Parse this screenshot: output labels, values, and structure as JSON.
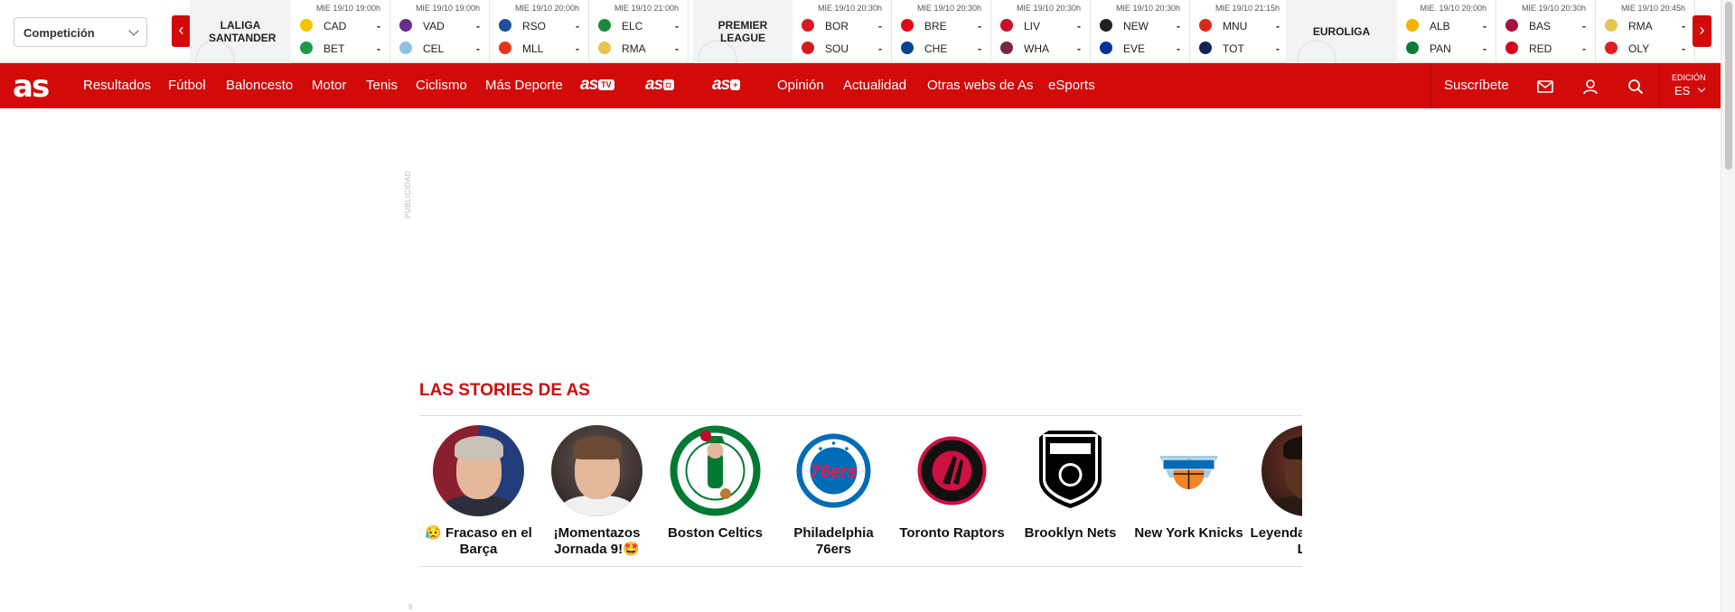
{
  "scoreboard": {
    "competition_select": "Competición",
    "prev_label": "‹",
    "next_label": "›",
    "competitions": [
      {
        "name": "LALIGA SANTANDER"
      },
      {
        "name": "PREMIER LEAGUE"
      },
      {
        "name": "EUROLIGA"
      }
    ],
    "matches": [
      {
        "date": "MIE 19/10 19:00h",
        "home": "CAD",
        "away": "BET",
        "home_score": "-",
        "away_score": "-",
        "home_color": "#f2c500",
        "away_color": "#1a9a4a"
      },
      {
        "date": "MIE 19/10 19:00h",
        "home": "VAD",
        "away": "CEL",
        "home_score": "-",
        "away_score": "-",
        "home_color": "#6b2d8a",
        "away_color": "#8fc1e3"
      },
      {
        "date": "MIE 19/10 20:00h",
        "home": "RSO",
        "away": "MLL",
        "home_score": "-",
        "away_score": "-",
        "home_color": "#1d4f9c",
        "away_color": "#e5361b"
      },
      {
        "date": "MIE 19/10 21:00h",
        "home": "ELC",
        "away": "RMA",
        "home_score": "-",
        "away_score": "-",
        "home_color": "#1b8a3e",
        "away_color": "#e7c450"
      },
      {
        "date": "MIE 19/10 20:30h",
        "home": "BOR",
        "away": "SOU",
        "home_score": "-",
        "away_score": "-",
        "home_color": "#d71920",
        "away_color": "#d71920"
      },
      {
        "date": "MIE 19/10 20:30h",
        "home": "BRE",
        "away": "CHE",
        "home_score": "-",
        "away_score": "-",
        "home_color": "#e30613",
        "away_color": "#034694"
      },
      {
        "date": "MIE 19/10 20:30h",
        "home": "LIV",
        "away": "WHA",
        "home_score": "-",
        "away_score": "-",
        "home_color": "#c8102e",
        "away_color": "#7a263a"
      },
      {
        "date": "MIE 19/10 20:30h",
        "home": "NEW",
        "away": "EVE",
        "home_score": "-",
        "away_score": "-",
        "home_color": "#241f20",
        "away_color": "#003399"
      },
      {
        "date": "MIE 19/10 21:15h",
        "home": "MNU",
        "away": "TOT",
        "home_score": "-",
        "away_score": "-",
        "home_color": "#da291c",
        "away_color": "#132257"
      },
      {
        "date": "MIE. 19/10 20:00h",
        "home": "ALB",
        "away": "PAN",
        "home_score": "-",
        "away_score": "-",
        "home_color": "#f2b400",
        "away_color": "#0a7d3b"
      },
      {
        "date": "MIE 19/10 20:30h",
        "home": "BAS",
        "away": "RED",
        "home_score": "-",
        "away_score": "-",
        "home_color": "#a4123f",
        "away_color": "#d6001c"
      },
      {
        "date": "MIE 19/10 20:45h",
        "home": "RMA",
        "away": "OLY",
        "home_score": "-",
        "away_score": "-",
        "home_color": "#e7c450",
        "away_color": "#e31b23"
      }
    ]
  },
  "nav": {
    "logo": "as",
    "items": [
      "Resultados",
      "Fútbol",
      "Baloncesto",
      "Motor",
      "Tenis",
      "Ciclismo",
      "Más Deporte"
    ],
    "brand_tv": "as",
    "brand_tv_tag": "TV",
    "brand_photo": "as",
    "brand_photo_tag": "◘",
    "brand_plus": "as",
    "brand_plus_tag": "+",
    "items2": [
      "Opinión",
      "Actualidad",
      "Otras webs de As",
      "eSports"
    ],
    "subscribe": "Suscríbete",
    "edition_label": "EDICIÓN",
    "edition_value": "ES"
  },
  "ad": {
    "label": "PUBLICIDAD",
    "label2": "9"
  },
  "stories": {
    "title": "LAS STORIES DE AS",
    "items": [
      {
        "caption": "😥 Fracaso en el Barça"
      },
      {
        "caption": "¡Momentazos Jornada 9!🤩"
      },
      {
        "caption": "Boston Celtics"
      },
      {
        "caption": "Philadelphia 76ers"
      },
      {
        "caption": "Toronto Raptors"
      },
      {
        "caption": "Brooklyn Nets"
      },
      {
        "caption": "New York Knicks"
      },
      {
        "caption": "Leyendas: mate a L..."
      }
    ]
  },
  "colors": {
    "brand_red": "#d20a0a",
    "text_dark": "#111111"
  }
}
